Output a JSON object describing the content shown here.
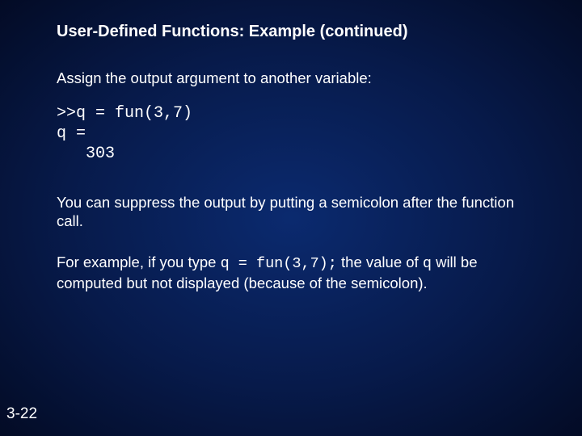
{
  "title": "User-Defined Functions: Example (continued)",
  "line1": "Assign the output argument to another variable:",
  "code": {
    "l1": ">>q = fun(3,7)",
    "l2": "q =",
    "l3": "   303"
  },
  "para2": {
    "t1": "You can suppress the output by putting a semicolon after the function call."
  },
  "para3": {
    "t1": "For example, if you type ",
    "c1": "q = fun(3,7);",
    "t2": " the value of ",
    "c2": "q",
    "t3": " will be computed but not displayed (because of the semicolon)."
  },
  "page": "3-22"
}
